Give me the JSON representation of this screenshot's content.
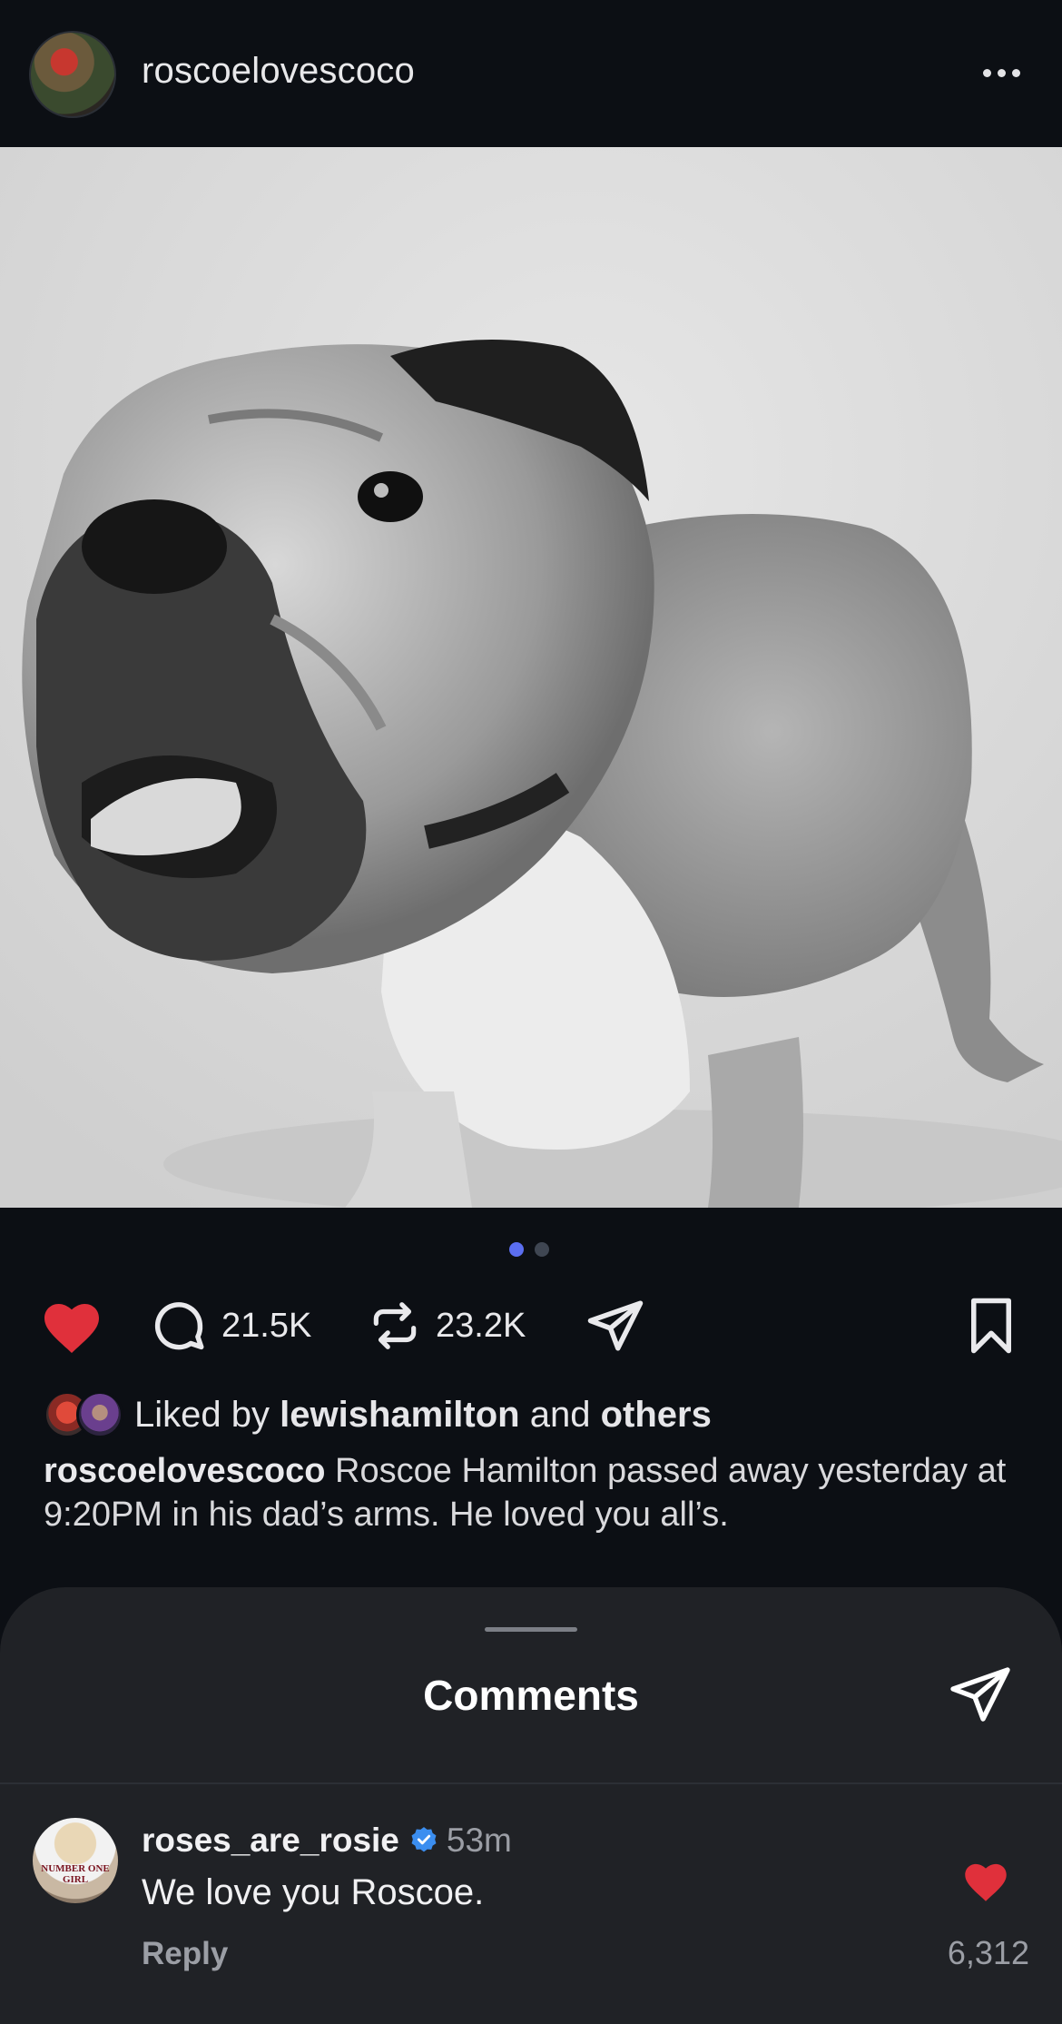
{
  "header": {
    "username": "roscoelovescoco",
    "avatar_icon": "profile-avatar",
    "more_icon": "more-horizontal-icon"
  },
  "post": {
    "image_description_icon": "photo",
    "carousel": {
      "count": 2,
      "active_index": 0
    },
    "actions": {
      "like_icon": "heart-filled-icon",
      "liked": true,
      "like_color": "#e0303b",
      "comments_count": "21.5K",
      "reposts_count": "23.2K",
      "share_icon": "send-icon",
      "save_icon": "bookmark-icon"
    },
    "liked_by": {
      "prefix": "Liked by",
      "user": "lewishamilton",
      "conjunction": "and",
      "others": "others"
    },
    "caption": {
      "username": "roscoelovescoco",
      "text": "Roscoe Hamilton passed away yesterday at 9:20PM in his dad’s arms. He loved you all’s."
    }
  },
  "comments_sheet": {
    "title": "Comments",
    "share_icon": "send-icon",
    "items": [
      {
        "username": "roses_are_rosie",
        "verified": true,
        "time": "53m",
        "text": "We love you Roscoe.",
        "reply_label": "Reply",
        "likes": "6,312",
        "liked": true,
        "avatar_shirt_text": "NUMBER ONE GIRL"
      }
    ]
  },
  "colors": {
    "background": "#0c0f14",
    "sheet": "#202226",
    "accent_blue": "#5b6ef0",
    "verified_blue": "#3b8ef0",
    "heart_red": "#e0303b"
  }
}
